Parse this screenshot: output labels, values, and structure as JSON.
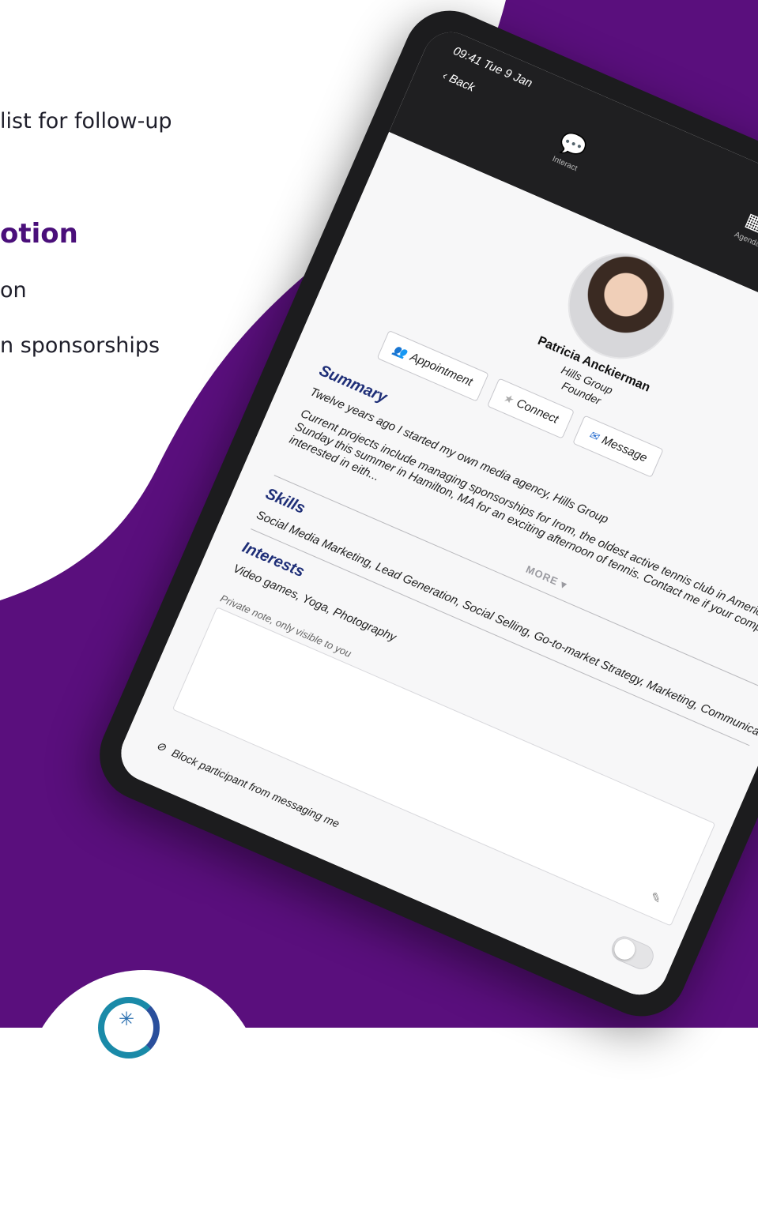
{
  "marketing": {
    "line_1": "list for follow-up",
    "heading": "otion",
    "line_2": "on",
    "line_3": "n sponsorships"
  },
  "colors": {
    "purple_dark": "#4a0f7a",
    "purple_bg": "#5a0f7d",
    "accent_blue": "#1f2f78"
  },
  "status_bar": {
    "time": "09:41",
    "date": "Tue 9 Jan"
  },
  "nav": {
    "back_label": "Back",
    "interact_label": "Interact",
    "agenda_label": "Agenda"
  },
  "profile": {
    "name": "Patricia Anckierman",
    "company": "Hills Group",
    "role": "Founder"
  },
  "actions": {
    "appointment": "Appointment",
    "connect": "Connect",
    "message": "Message"
  },
  "summary": {
    "title": "Summary",
    "intro": "Twelve years ago I started my own media agency, Hills Group",
    "body_line_1": "Current projects include managing sponsorships for Irom, the oldest active tennis club in America. Join us e",
    "body_line_2": "Sunday this summer in Hamilton, MA for an exciting afternoon of tennis. Contact me if your company would b",
    "body_line_3": "interested in eith...",
    "more_label": "MORE"
  },
  "skills": {
    "title": "Skills",
    "text": "Social Media Marketing, Lead Generation, Social Selling, Go-to-market Strategy, Marketing, Communications"
  },
  "interests": {
    "title": "Interests",
    "text": "Video games, Yoga, Photography"
  },
  "private_note": {
    "placeholder": "Private note, only visible to you"
  },
  "block": {
    "label": "Block participant from messaging me"
  }
}
